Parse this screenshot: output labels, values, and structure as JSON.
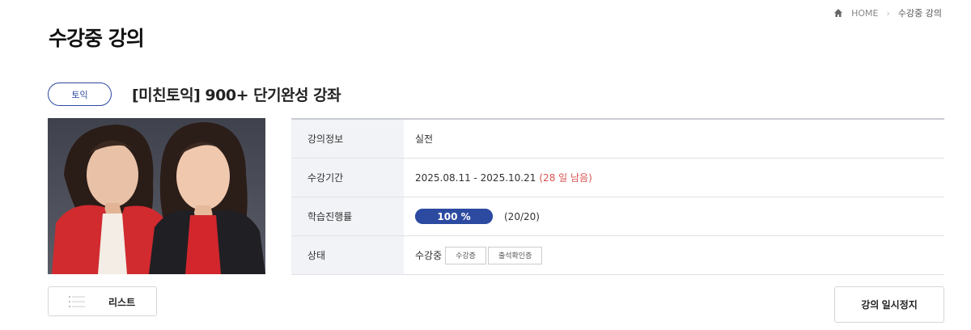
{
  "breadcrumb": {
    "home": "HOME",
    "current": "수강중 강의"
  },
  "page": {
    "title": "수강중 강의"
  },
  "course": {
    "category": "토익",
    "title": "[미친토익] 900+ 단기완성 강좌",
    "thumbnail_icon": "instructors-photo"
  },
  "info": {
    "rows": [
      {
        "label": "강의정보",
        "value": "실전"
      },
      {
        "label": "수강기간",
        "value": "2025.08.11 - 2025.10.21",
        "remain": "(28 일 남음)"
      },
      {
        "label": "학습진행률",
        "progress_text": "100 %",
        "progress_fraction": 1.0,
        "count": "(20/20)"
      },
      {
        "label": "상태",
        "value": "수강중",
        "buttons": [
          "수강증",
          "출석확인증"
        ]
      }
    ]
  },
  "actions": {
    "list": "리스트",
    "pause": "강의 일시정지"
  },
  "colors": {
    "accent": "#2c4aa0",
    "remain": "#d9534f"
  }
}
